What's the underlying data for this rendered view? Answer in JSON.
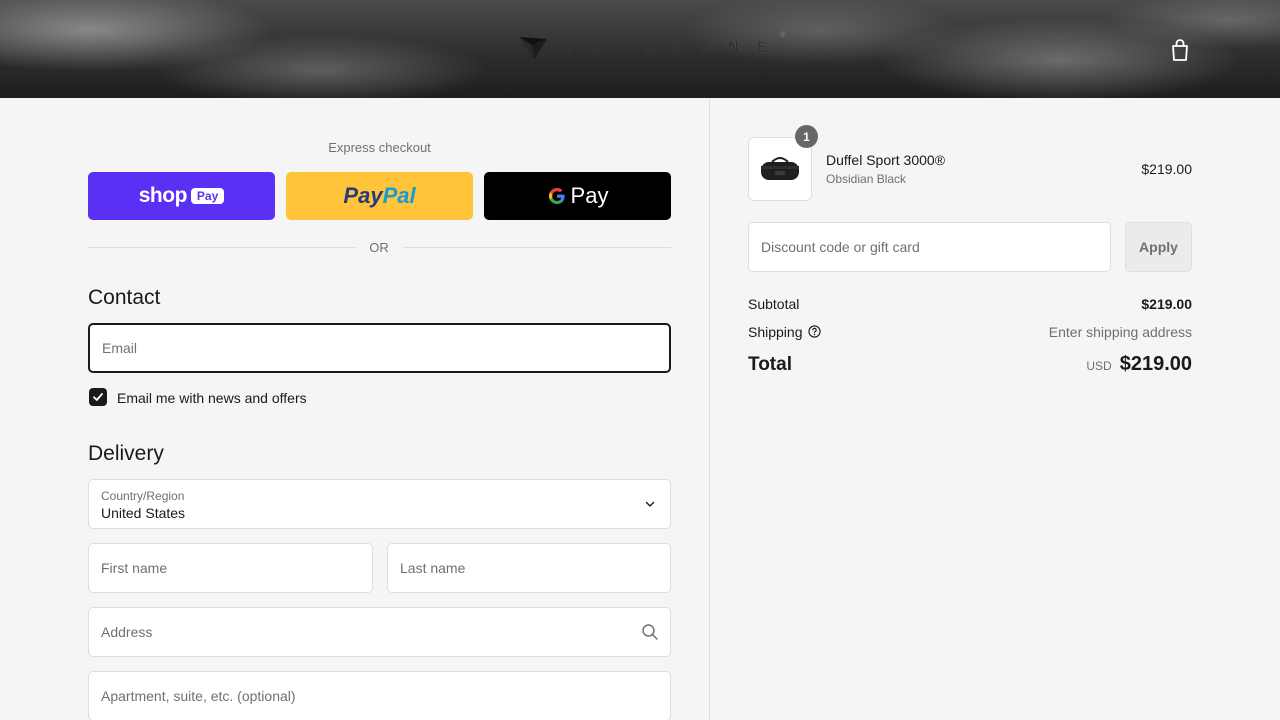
{
  "header": {
    "brand": "SKYBORNE",
    "brand_mark": "®",
    "cart_icon": "shopping-bag-icon"
  },
  "express": {
    "label": "Express checkout",
    "shop_pay_word": "shop",
    "shop_pay_pill": "Pay",
    "paypal_a": "Pay",
    "paypal_b": "Pal",
    "gpay_letter": "G",
    "gpay_word": "Pay",
    "or_text": "OR",
    "colors": {
      "shop": "#5a31f4",
      "paypal": "#ffc439",
      "gpay": "#000000"
    }
  },
  "contact": {
    "title": "Contact",
    "email_placeholder": "Email",
    "newsletter_label": "Email me with news and offers",
    "newsletter_checked": true
  },
  "delivery": {
    "title": "Delivery",
    "country_label": "Country/Region",
    "country_value": "United States",
    "first_name_placeholder": "First name",
    "last_name_placeholder": "Last name",
    "address_placeholder": "Address",
    "apartment_placeholder": "Apartment, suite, etc. (optional)"
  },
  "order": {
    "item": {
      "quantity": "1",
      "name": "Duffel Sport 3000®",
      "variant": "Obsidian Black",
      "price": "$219.00"
    },
    "discount_placeholder": "Discount code or gift card",
    "apply_label": "Apply",
    "subtotal_label": "Subtotal",
    "subtotal_value": "$219.00",
    "shipping_label": "Shipping",
    "shipping_value": "Enter shipping address",
    "total_label": "Total",
    "currency": "USD",
    "total_value": "$219.00"
  }
}
